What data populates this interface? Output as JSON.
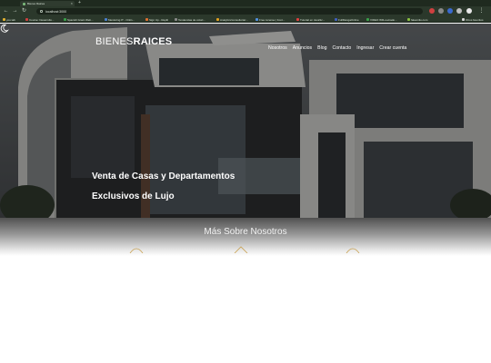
{
  "browser": {
    "tab_title": "Bienes Raices",
    "url": "localhost:3000",
    "bookmarks": [
      {
        "label": "you tab",
        "color": "#e0b030"
      },
      {
        "label": "Course: Desarrollo...",
        "color": "#d04040"
      },
      {
        "label": "Spanish Grant Web...",
        "color": "#3aa04a"
      },
      {
        "label": "Mentoring IT - Onlin...",
        "color": "#4a80d0"
      },
      {
        "label": "Sign Up - Replit",
        "color": "#e07030"
      },
      {
        "label": "Tendencias de colori...",
        "color": "#8a8a8a"
      },
      {
        "label": "Analytics/consultoria/...",
        "color": "#e0a020"
      },
      {
        "label": "Free License | Font...",
        "color": "#5090e0"
      },
      {
        "label": "Tutorial en JavaSc...",
        "color": "#e04040"
      },
      {
        "label": "FullMangaOnline",
        "color": "#4060c0"
      },
      {
        "label": "VIDEO WR+Letrado...",
        "color": "#3aa04a"
      },
      {
        "label": "fakemilio.com",
        "color": "#8ac040"
      },
      {
        "label": "Otros favoritos",
        "color": "#d8d8d8"
      }
    ]
  },
  "header": {
    "logo_thin": "BIENES",
    "logo_bold": "RAICES",
    "nav": [
      "Nosotros",
      "Anuncios",
      "Blog",
      "Contacto",
      "Ingresar",
      "Crear cuenta"
    ]
  },
  "hero": {
    "line1": "Venta de Casas y Departamentos",
    "line2": "Exclusivos de Lujo"
  },
  "section": {
    "title": "Más Sobre Nosotros"
  },
  "colors": {
    "overlay": "#0a0a0a",
    "feature_icon": "#c8a050"
  }
}
